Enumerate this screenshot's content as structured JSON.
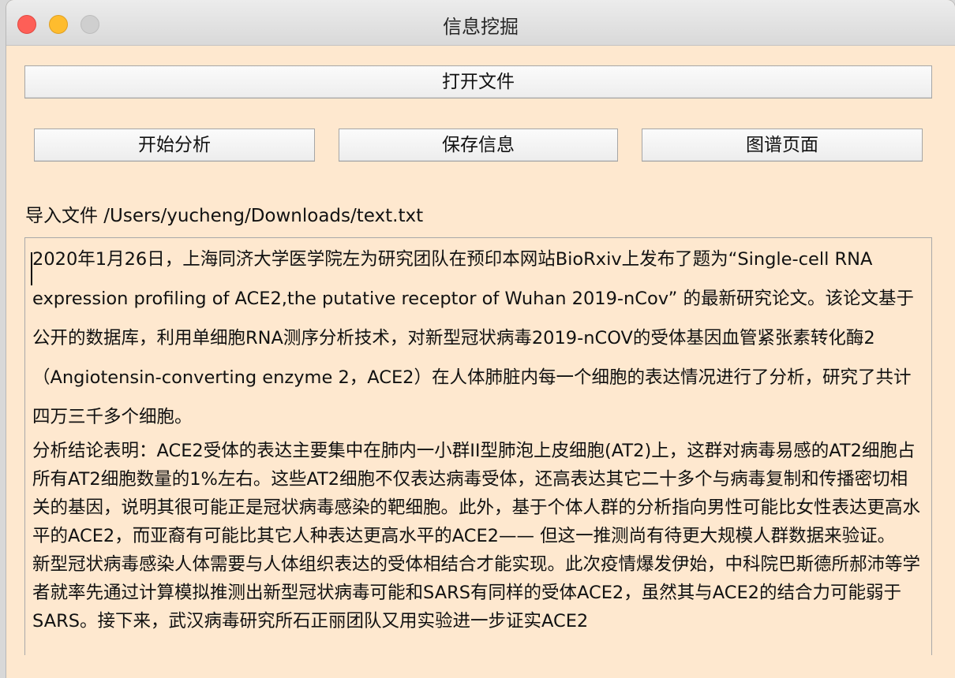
{
  "window": {
    "title": "信息挖掘"
  },
  "toolbar": {
    "open_file": "打开文件",
    "start_analysis": "开始分析",
    "save_info": "保存信息",
    "graph_page": "图谱页面"
  },
  "file": {
    "label": "导入文件 /Users/yucheng/Downloads/text.txt"
  },
  "content": {
    "paragraph1": "2020年1月26日，上海同济大学医学院左为研究团队在预印本网站BioRxiv上发布了题为“Single-cell RNA expression profiling of ACE2,the putative receptor of Wuhan 2019-nCov” 的最新研究论文。该论文基于公开的数据库，利用单细胞RNA测序分析技术，对新型冠状病毒2019-nCOV的受体基因血管紧张素转化酶2（Angiotensin-converting enzyme 2，ACE2）在人体肺脏内每一个细胞的表达情况进行了分析，研究了共计四万三千多个细胞。",
    "paragraph2": "分析结论表明：ACE2受体的表达主要集中在肺内一小群II型肺泡上皮细胞(AT2)上，这群对病毒易感的AT2细胞占所有AT2细胞数量的1%左右。这些AT2细胞不仅表达病毒受体，还高表达其它二十多个与病毒复制和传播密切相关的基因，说明其很可能正是冠状病毒感染的靶细胞。此外，基于个体人群的分析指向男性可能比女性表达更高水平的ACE2，而亚裔有可能比其它人种表达更高水平的ACE2—— 但这一推测尚有待更大规模人群数据来验证。",
    "paragraph3": "新型冠状病毒感染人体需要与人体组织表达的受体相结合才能实现。此次疫情爆发伊始，中科院巴斯德所郝沛等学者就率先通过计算模拟推测出新型冠状病毒可能和SARS有同样的受体ACE2，虽然其与ACE2的结合力可能弱于SARS。接下来，武汉病毒研究所石正丽团队又用实验进一步证实ACE2"
  }
}
